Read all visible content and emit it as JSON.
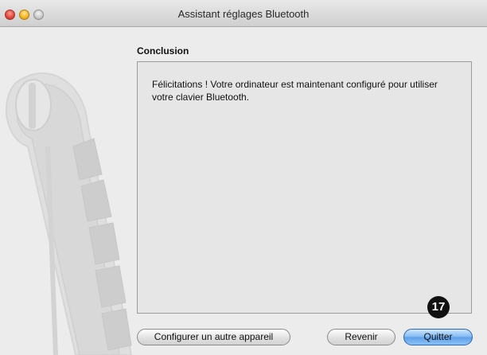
{
  "window": {
    "title": "Assistant réglages Bluetooth"
  },
  "page": {
    "heading": "Conclusion",
    "message": "Félicitations ! Votre ordinateur est maintenant configuré pour utiliser votre clavier Bluetooth."
  },
  "buttons": {
    "configure_other": "Configurer un autre appareil",
    "back": "Revenir",
    "quit": "Quitter"
  },
  "callout": {
    "number": "17"
  },
  "colors": {
    "close": "#e0443a",
    "minimize": "#f2b31d",
    "zoom": "#c9c9c9",
    "default_button": "#5c9ee8"
  },
  "icons": {
    "sidebar": "bluetooth-keyboard-art"
  }
}
